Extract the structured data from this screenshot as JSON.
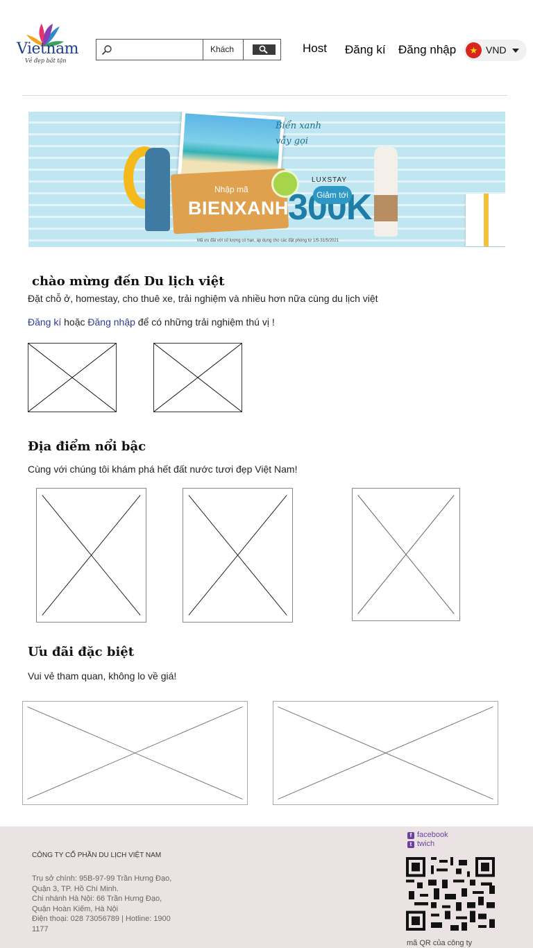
{
  "header": {
    "logo_text": "Vietnam",
    "logo_tagline": "Vẻ đẹp bất tận",
    "search": {
      "placeholder": "",
      "guest_label": "Khách"
    },
    "nav": {
      "host": "Host",
      "register": "Đăng kí",
      "login": "Đăng nhập"
    },
    "currency": "VND"
  },
  "banner": {
    "script_text": "Biển xanh vẫy gọi",
    "code_label": "Nhập mã",
    "code": "BIENXANH",
    "brand": "LUXSTAY",
    "discount_prefix": "Giảm tới",
    "discount": "300K",
    "fine_print": "Mã ưu đãi với số lượng có hạn, áp dụng cho các đặt phòng từ 1/5-31/5/2021"
  },
  "welcome": {
    "title": "chào mừng đến Du lịch việt",
    "subtitle": "Đặt chỗ ở, homestay, cho thuê xe, trải nghiệm và nhiều hơn nữa cùng du lịch việt",
    "register_link": "Đăng kí",
    "middle_text": " hoặc ",
    "login_link": "Đăng nhập",
    "tail_text": " để có những trải nghiệm thú vị !"
  },
  "featured": {
    "title": "Địa điểm nổi bậc",
    "subtitle": "Cùng với chúng tôi khám phá hết đất nước tươi đẹp Việt Nam!"
  },
  "deals": {
    "title": "Ưu đãi đặc biệt",
    "subtitle": "Vui vẻ tham quan, không lo về giá!"
  },
  "footer": {
    "company": "CÔNG TY CỔ PHẦN DU LỊCH VIỆT NAM",
    "address_lines": [
      "Trụ sở chính: 95B-97-99 Trần Hưng Đạo,",
      "Quận 3, TP. Hồ Chí Minh.",
      "Chi nhánh Hà Nội: 66 Trần Hưng Đạo,",
      "Quận Hoàn Kiếm, Hà Nội",
      "Điện thoại: 028 73056789 | Hotline: 1900",
      "1177"
    ],
    "social": [
      "facebook",
      "twich"
    ],
    "qr_caption": "mã QR của công ty"
  },
  "colors": {
    "link": "#2c3b9a",
    "footer_bg": "#ebe3e3",
    "social": "#6c3fa2",
    "flag_red": "#da251d"
  },
  "icons": [
    "search-icon",
    "vn-flag-icon",
    "caret-down-icon",
    "facebook-icon",
    "twitch-icon"
  ]
}
